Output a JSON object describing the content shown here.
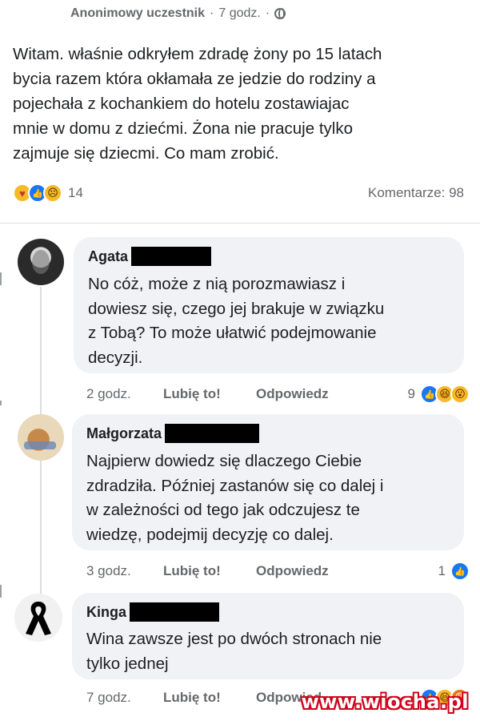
{
  "post": {
    "author": "Anonimowy uczestnik",
    "time": "7 godz.",
    "separator": "·",
    "text": "Witam. właśnie odkryłem zdradę żony po 15 latach\nbycia razem która okłamała  ze jedzie do rodziny a\npojechała z kochankiem do hotelu zostawiajac\nmnie w domu z dziećmi. Żona nie pracuje tylko\nzajmuje się dziecmi. Co mam zrobić.",
    "reactions_count": "14",
    "reaction_icons": [
      "care-icon",
      "like-icon",
      "sad-icon"
    ],
    "comments_label": "Komentarze: 98"
  },
  "comments": [
    {
      "name": "Agata",
      "text": "No cóż, może z nią porozmawiasz i\ndowiesz się, czego jej brakuje w związku\nz Tobą? To może ułatwić podejmowanie\ndecyzji.",
      "time": "2 godz.",
      "like_label": "Lubię to!",
      "reply_label": "Odpowiedz",
      "reactions_count": "9",
      "reaction_icons": [
        "like-icon",
        "haha-icon",
        "wow-icon"
      ]
    },
    {
      "name": "Małgorzata",
      "text": "Najpierw dowiedz się dlaczego Ciebie\nzdradziła. Później zastanów się co dalej i\nw zależności od tego jak odczujesz te\nwiedzę, podejmij decyzję co dalej.",
      "time": "3 godz.",
      "like_label": "Lubię to!",
      "reply_label": "Odpowiedz",
      "reactions_count": "1",
      "reaction_icons": [
        "like-icon"
      ]
    },
    {
      "name": "Kinga",
      "text": "Wina zawsze jest po dwóch stronach nie\ntylko jednej",
      "time": "7 godz.",
      "like_label": "Lubię to!",
      "reply_label": "Odpowied",
      "reaction_icons": [
        "like-icon",
        "haha-icon",
        "angry-icon"
      ]
    }
  ],
  "watermark": "www.wiocha.pl",
  "colors": {
    "accent": "#1877f2",
    "bubble": "#f0f2f5",
    "muted_text": "#65676b",
    "watermark": "#d0021b"
  }
}
